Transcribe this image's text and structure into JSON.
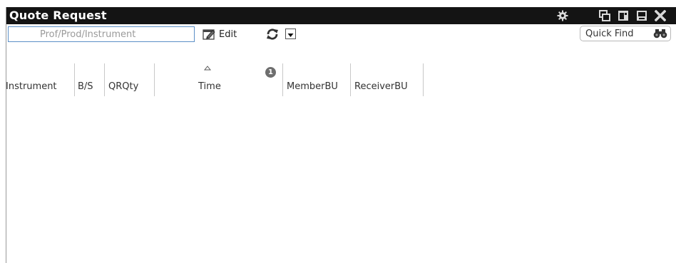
{
  "window": {
    "title": "Quote Request"
  },
  "titlebar_icons": [
    "gear-icon",
    "window-restore-icon",
    "window-dock-icon",
    "window-minimize-icon",
    "close-icon"
  ],
  "toolbar": {
    "search_placeholder": "Prof/Prod/Instrument",
    "edit_label": "Edit",
    "quickfind_label": "Quick Find"
  },
  "grid": {
    "columns": [
      {
        "label": "Instrument"
      },
      {
        "label": "B/S"
      },
      {
        "label": "QRQty"
      },
      {
        "label": "Time",
        "sort": "ascending",
        "sort_priority": "1"
      },
      {
        "label": "MemberBU"
      },
      {
        "label": "ReceiverBU"
      }
    ],
    "rows": []
  },
  "colors": {
    "titlebar_bg": "#141414",
    "titlebar_text": "#ffffff",
    "search_border": "#5b8fc7"
  }
}
